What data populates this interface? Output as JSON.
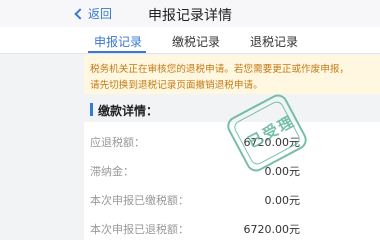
{
  "nav": {
    "back_label": "返回",
    "title": "申报记录详情"
  },
  "tabs": [
    {
      "label": "申报记录",
      "active": true
    },
    {
      "label": "缴税记录",
      "active": false
    },
    {
      "label": "退税记录",
      "active": false
    }
  ],
  "notice": {
    "line1": "税务机关正在审核您的退税申请。若您需要更正或作废申报，",
    "line2": "请先切换到退税记录页面撤销退税申请。"
  },
  "section": {
    "title": "缴款详情："
  },
  "rows": [
    {
      "label": "应退税额：",
      "value": "6720.00元"
    },
    {
      "label": "滞纳金：",
      "value": "0.00元"
    },
    {
      "label": "本次申报已缴税额：",
      "value": "0.00元"
    },
    {
      "label": "本次申报已退税额：",
      "value": "6720.00元"
    }
  ],
  "stamp": {
    "text": "已受理"
  },
  "colors": {
    "accent": "#3a78d4",
    "notice_text": "#c47a16",
    "notice_bg": "#fff7e0",
    "stamp": "#5fb49a"
  }
}
